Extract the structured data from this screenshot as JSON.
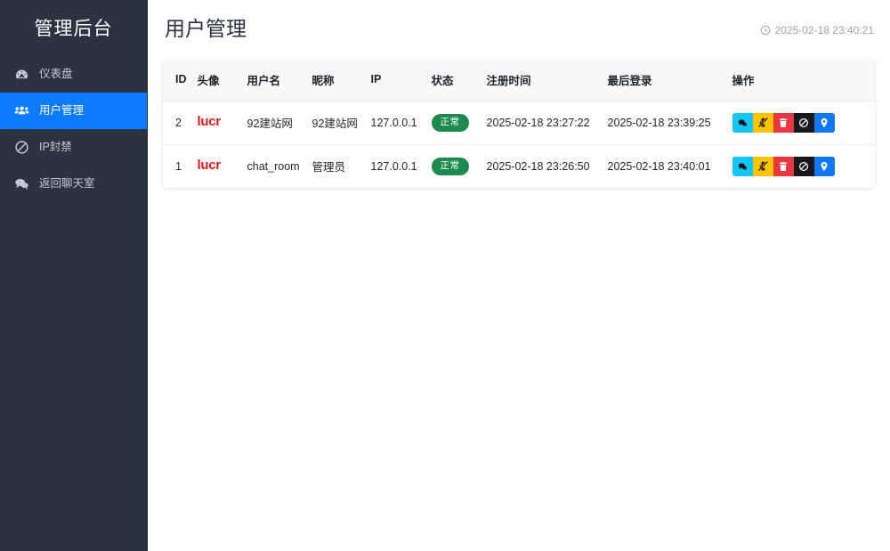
{
  "sidebar": {
    "title": "管理后台",
    "items": [
      {
        "label": "仪表盘",
        "icon": "dashboard-icon",
        "active": false
      },
      {
        "label": "用户管理",
        "icon": "users-icon",
        "active": true
      },
      {
        "label": "IP封禁",
        "icon": "ban-icon",
        "active": false
      },
      {
        "label": "返回聊天室",
        "icon": "comments-icon",
        "active": false
      }
    ]
  },
  "header": {
    "title": "用户管理",
    "clock_icon": "clock-icon",
    "timestamp": "2025-02-18 23:40:21"
  },
  "table": {
    "columns": [
      "ID",
      "头像",
      "用户名",
      "昵称",
      "IP",
      "状态",
      "注册时间",
      "最后登录",
      "操作"
    ],
    "rows": [
      {
        "id": "2",
        "avatar_alt": "lucr",
        "username": "92建站网",
        "nickname": "92建站网",
        "ip": "127.0.0.1",
        "status": "正常",
        "registered_at": "2025-02-18 23:27:22",
        "last_login": "2025-02-18 23:39:25"
      },
      {
        "id": "1",
        "avatar_alt": "lucr",
        "username": "chat_room",
        "nickname": "管理员",
        "ip": "127.0.0.1",
        "status": "正常",
        "registered_at": "2025-02-18 23:26:50",
        "last_login": "2025-02-18 23:40:01"
      }
    ],
    "actions": [
      {
        "name": "chat-button",
        "icon": "comment-icon",
        "color": "#13c6f3"
      },
      {
        "name": "mute-button",
        "icon": "mic-slash-icon",
        "color": "#fcc400"
      },
      {
        "name": "delete-button",
        "icon": "trash-icon",
        "color": "#e8383f"
      },
      {
        "name": "ban-button",
        "icon": "ban-icon",
        "color": "#17191c"
      },
      {
        "name": "locate-button",
        "icon": "map-marker-icon",
        "color": "#1178f2"
      }
    ]
  },
  "colors": {
    "sidebar_bg": "#2b3240",
    "active_nav": "#0d7bff",
    "status_green": "#1a8a4d",
    "title_text": "#2c3240",
    "muted_text": "#9aa3ad"
  }
}
